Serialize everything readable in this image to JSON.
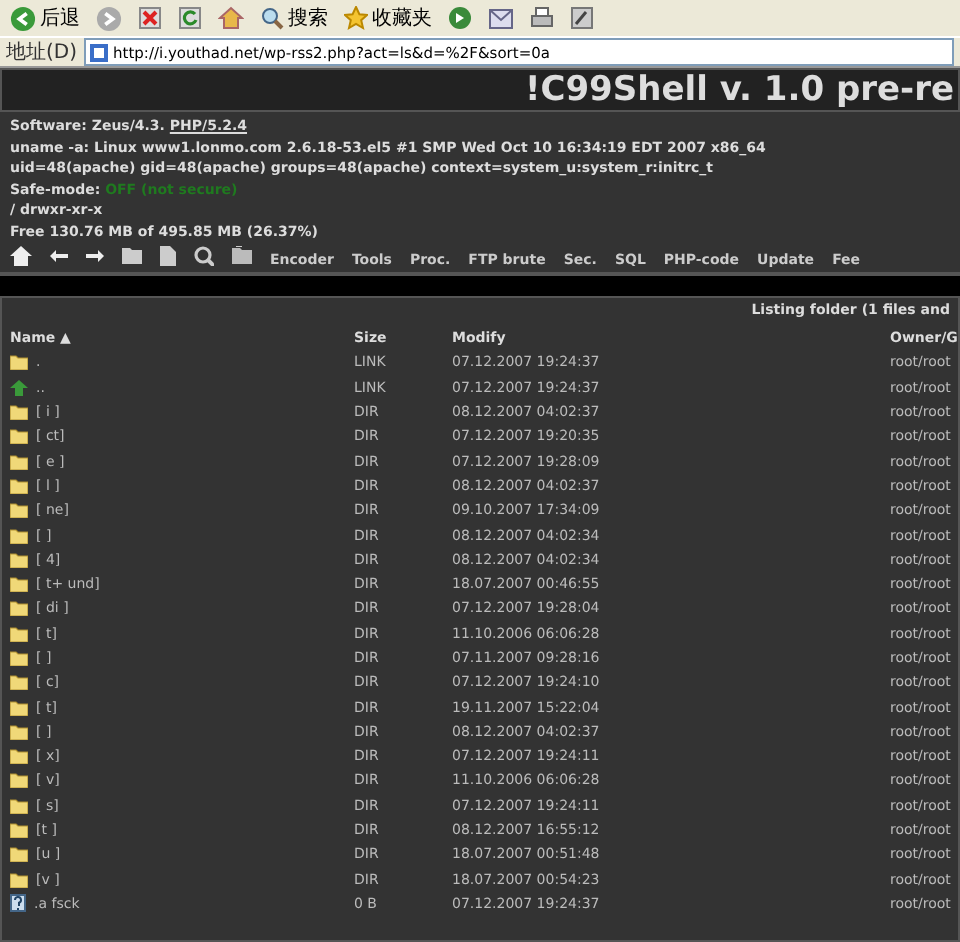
{
  "browser": {
    "toolbar": [
      {
        "kind": "back",
        "label": "后退"
      },
      {
        "kind": "forward"
      },
      {
        "kind": "stop"
      },
      {
        "kind": "refresh"
      },
      {
        "kind": "home"
      },
      {
        "kind": "search",
        "label": "搜索"
      },
      {
        "kind": "favorites",
        "label": "收藏夹"
      },
      {
        "kind": "media"
      },
      {
        "kind": "mail"
      },
      {
        "kind": "print"
      },
      {
        "kind": "edit"
      }
    ],
    "address_label": "地址(D)",
    "url": "http://i.youthad.net/wp-rss2.php?act=ls&d=%2F&sort=0a"
  },
  "shell": {
    "title": "!C99Shell v. 1.0 pre-re",
    "info": [
      {
        "label": "Software: Zeus/4.3. ",
        "link": "PHP/5.2.4"
      },
      {
        "label": "uname -a: Linux www1.lonmo.com 2.6.18-53.el5 #1 SMP Wed Oct 10 16:34:19 EDT 2007 x86_64"
      },
      {
        "label": "uid=48(apache) gid=48(apache) groups=48(apache) context=system_u:system_r:initrc_t"
      },
      {
        "label": "Safe-mode: ",
        "status": "OFF (not secure)"
      },
      {
        "label": "/  drwxr-xr-x"
      },
      {
        "label": "Free 130.76 MB of 495.85 MB (26.37%)"
      }
    ],
    "nav_icons": [
      {
        "kind": "home"
      },
      {
        "kind": "back"
      },
      {
        "kind": "forward"
      },
      {
        "kind": "folder"
      },
      {
        "kind": "document"
      },
      {
        "kind": "search"
      },
      {
        "kind": "folders"
      }
    ],
    "nav_links": [
      "Encoder",
      "Tools",
      "Proc.",
      "FTP brute",
      "Sec.",
      "SQL",
      "PHP-code",
      "Update",
      "Fee"
    ],
    "listing_caption": "Listing folder (1 files and",
    "table": {
      "columns": [
        "Name ▲",
        "Size",
        "Modify",
        "Owner/G"
      ],
      "rows": [
        {
          "kind": "folder",
          "name": ".",
          "size": "LINK",
          "modify": "07.12.2007 19:24:37",
          "owner": "root/root"
        },
        {
          "kind": "up",
          "name": "..",
          "size": "LINK",
          "modify": "07.12.2007 19:24:37",
          "owner": "root/root"
        },
        {
          "kind": "folder",
          "name": "[ i ]",
          "size": "DIR",
          "modify": "08.12.2007 04:02:37",
          "owner": "root/root"
        },
        {
          "kind": "folder",
          "name": "[ ct]",
          "size": "DIR",
          "modify": "07.12.2007 19:20:35",
          "owner": "root/root"
        },
        {
          "kind": "folder",
          "name": "[ e ]",
          "size": "DIR",
          "modify": "07.12.2007 19:28:09",
          "owner": "root/root"
        },
        {
          "kind": "folder",
          "name": "[ l ]",
          "size": "DIR",
          "modify": "08.12.2007 04:02:37",
          "owner": "root/root"
        },
        {
          "kind": "folder",
          "name": "[ ne]",
          "size": "DIR",
          "modify": "09.10.2007 17:34:09",
          "owner": "root/root"
        },
        {
          "kind": "folder",
          "name": "[ ]",
          "size": "DIR",
          "modify": "08.12.2007 04:02:34",
          "owner": "root/root"
        },
        {
          "kind": "folder",
          "name": "[ 4]",
          "size": "DIR",
          "modify": "08.12.2007 04:02:34",
          "owner": "root/root"
        },
        {
          "kind": "folder",
          "name": "[ t+ und]",
          "size": "DIR",
          "modify": "18.07.2007 00:46:55",
          "owner": "root/root"
        },
        {
          "kind": "folder",
          "name": "[ di ]",
          "size": "DIR",
          "modify": "07.12.2007 19:28:04",
          "owner": "root/root"
        },
        {
          "kind": "folder",
          "name": "[ t]",
          "size": "DIR",
          "modify": "11.10.2006 06:06:28",
          "owner": "root/root"
        },
        {
          "kind": "folder",
          "name": "[ ]",
          "size": "DIR",
          "modify": "07.11.2007 09:28:16",
          "owner": "root/root"
        },
        {
          "kind": "folder",
          "name": "[ c]",
          "size": "DIR",
          "modify": "07.12.2007 19:24:10",
          "owner": "root/root"
        },
        {
          "kind": "folder",
          "name": "[ t]",
          "size": "DIR",
          "modify": "19.11.2007 15:22:04",
          "owner": "root/root"
        },
        {
          "kind": "folder",
          "name": "[ ]",
          "size": "DIR",
          "modify": "08.12.2007 04:02:37",
          "owner": "root/root"
        },
        {
          "kind": "folder",
          "name": "[ x]",
          "size": "DIR",
          "modify": "07.12.2007 19:24:11",
          "owner": "root/root"
        },
        {
          "kind": "folder",
          "name": "[ v]",
          "size": "DIR",
          "modify": "11.10.2006 06:06:28",
          "owner": "root/root"
        },
        {
          "kind": "folder",
          "name": "[ s]",
          "size": "DIR",
          "modify": "07.12.2007 19:24:11",
          "owner": "root/root"
        },
        {
          "kind": "folder",
          "name": "[t ]",
          "size": "DIR",
          "modify": "08.12.2007 16:55:12",
          "owner": "root/root"
        },
        {
          "kind": "folder",
          "name": "[u ]",
          "size": "DIR",
          "modify": "18.07.2007 00:51:48",
          "owner": "root/root"
        },
        {
          "kind": "folder",
          "name": "[v ]",
          "size": "DIR",
          "modify": "18.07.2007 00:54:23",
          "owner": "root/root"
        },
        {
          "kind": "file",
          "name": ".a fsck",
          "size": "0 B",
          "modify": "07.12.2007 19:24:37",
          "owner": "root/root"
        }
      ]
    }
  }
}
